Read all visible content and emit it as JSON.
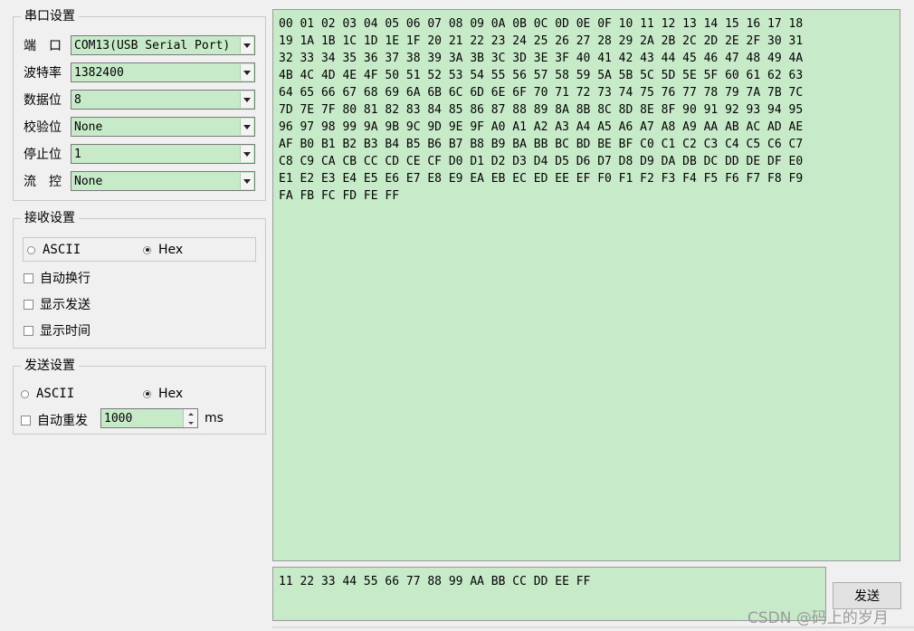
{
  "serial": {
    "title": "串口设置",
    "port": {
      "label": "端　口",
      "value": "COM13(USB Serial Port)"
    },
    "baud": {
      "label": "波特率",
      "value": "1382400"
    },
    "databits": {
      "label": "数据位",
      "value": "8"
    },
    "parity": {
      "label": "校验位",
      "value": "None"
    },
    "stopbits": {
      "label": "停止位",
      "value": "1"
    },
    "flow": {
      "label": "流　控",
      "value": "None"
    }
  },
  "receive": {
    "title": "接收设置",
    "ascii_label": "ASCII",
    "hex_label": "Hex",
    "auto_newline": "自动换行",
    "show_send": "显示发送",
    "show_time": "显示时间"
  },
  "send": {
    "title": "发送设置",
    "ascii_label": "ASCII",
    "hex_label": "Hex",
    "auto_resend": "自动重发",
    "interval": "1000",
    "unit": "ms",
    "button_label": "发送"
  },
  "recv_text": "00 01 02 03 04 05 06 07 08 09 0A 0B 0C 0D 0E 0F 10 11 12 13 14 15 16 17 18\n19 1A 1B 1C 1D 1E 1F 20 21 22 23 24 25 26 27 28 29 2A 2B 2C 2D 2E 2F 30 31\n32 33 34 35 36 37 38 39 3A 3B 3C 3D 3E 3F 40 41 42 43 44 45 46 47 48 49 4A\n4B 4C 4D 4E 4F 50 51 52 53 54 55 56 57 58 59 5A 5B 5C 5D 5E 5F 60 61 62 63\n64 65 66 67 68 69 6A 6B 6C 6D 6E 6F 70 71 72 73 74 75 76 77 78 79 7A 7B 7C\n7D 7E 7F 80 81 82 83 84 85 86 87 88 89 8A 8B 8C 8D 8E 8F 90 91 92 93 94 95\n96 97 98 99 9A 9B 9C 9D 9E 9F A0 A1 A2 A3 A4 A5 A6 A7 A8 A9 AA AB AC AD AE\nAF B0 B1 B2 B3 B4 B5 B6 B7 B8 B9 BA BB BC BD BE BF C0 C1 C2 C3 C4 C5 C6 C7\nC8 C9 CA CB CC CD CE CF D0 D1 D2 D3 D4 D5 D6 D7 D8 D9 DA DB DC DD DE DF E0\nE1 E2 E3 E4 E5 E6 E7 E8 E9 EA EB EC ED EE EF F0 F1 F2 F3 F4 F5 F6 F7 F8 F9\nFA FB FC FD FE FF",
  "send_text": "11 22 33 44 55 66 77 88 99 AA BB CC DD EE FF",
  "watermark": "CSDN @码上的岁月",
  "colors": {
    "field_bg": "#c7ebc9",
    "window_bg": "#f0f0f0"
  }
}
